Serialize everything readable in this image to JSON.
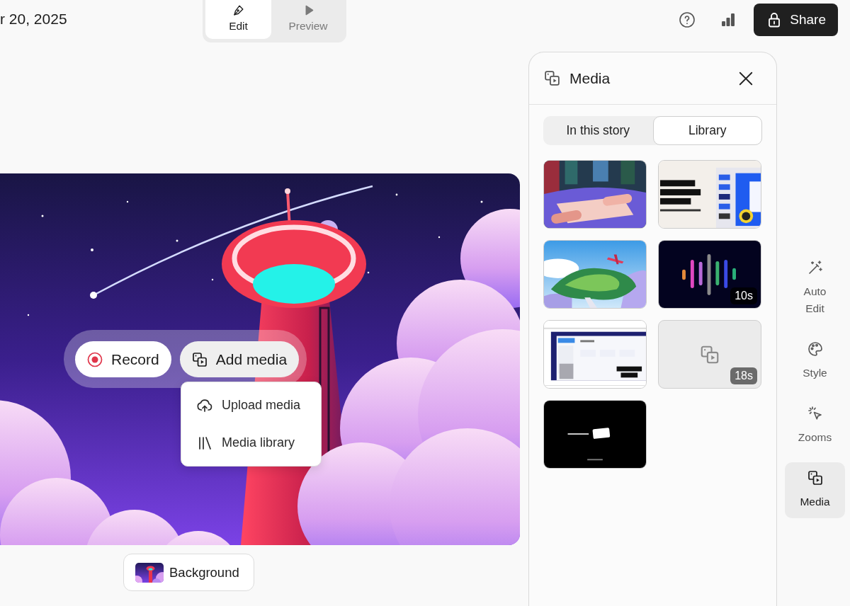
{
  "header": {
    "date": "r 20, 2025",
    "modes": [
      {
        "kind": "edit",
        "label": "Edit",
        "selected": true
      },
      {
        "kind": "preview",
        "label": "Preview",
        "selected": false
      }
    ],
    "share_button": "Share"
  },
  "canvas": {
    "actions": [
      {
        "kind": "record",
        "label": "Record",
        "expanded": false
      },
      {
        "kind": "media",
        "label": "Add media",
        "expanded": true
      }
    ],
    "menu": [
      {
        "kind": "upload",
        "label": "Upload media"
      },
      {
        "kind": "library",
        "label": "Media library"
      }
    ],
    "background_button": "Background"
  },
  "media_panel": {
    "title": "Media",
    "tabs": [
      {
        "label": "In this story",
        "selected": false
      },
      {
        "label": "Library",
        "selected": true
      }
    ],
    "items": [
      {
        "kind": "scroll"
      },
      {
        "kind": "slides"
      },
      {
        "kind": "landscape"
      },
      {
        "kind": "waveform",
        "duration": "10s"
      },
      {
        "kind": "screen"
      },
      {
        "kind": "placeholder",
        "duration": "18s"
      },
      {
        "kind": "title-card"
      }
    ]
  },
  "sidebar": {
    "items": [
      {
        "kind": "auto-edit",
        "label": "Auto Edit",
        "selected": false
      },
      {
        "kind": "style",
        "label": "Style",
        "selected": false
      },
      {
        "kind": "zooms",
        "label": "Zooms",
        "selected": false
      },
      {
        "kind": "media",
        "label": "Media",
        "selected": true
      }
    ]
  }
}
